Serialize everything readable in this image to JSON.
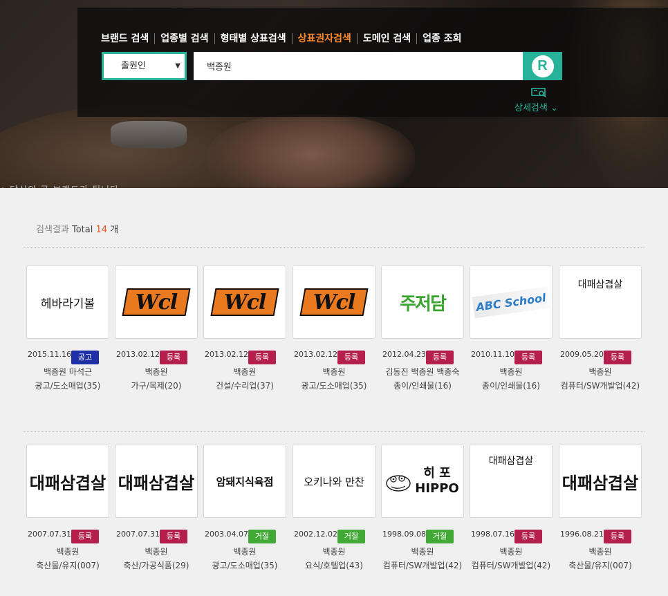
{
  "nav": {
    "items": [
      {
        "label": "브랜드 검색",
        "active": false
      },
      {
        "label": "업종별 검색",
        "active": false
      },
      {
        "label": "형태별 상표검색",
        "active": false
      },
      {
        "label": "상표권자검색",
        "active": true
      },
      {
        "label": "도메인 검색",
        "active": false
      },
      {
        "label": "업종 조회",
        "active": false
      }
    ]
  },
  "search": {
    "select_value": "출원인",
    "query": "백종원",
    "advanced_label": "상세검색"
  },
  "hero": {
    "ticker": "e 당신의 곧 브랜드가 됩니다"
  },
  "results": {
    "label": "검색결과",
    "total_label": "Total",
    "count": "14",
    "unit": "개",
    "items": [
      {
        "logo": "헤바라기볼",
        "date": "2015.11.16",
        "status": "공고",
        "owner": "백종원 마석근",
        "category": "광고/도소매업(35)"
      },
      {
        "logo": "Wcl",
        "date": "2013.02.12",
        "status": "등록",
        "owner": "백종원",
        "category": "가구/목제(20)"
      },
      {
        "logo": "Wcl",
        "date": "2013.02.12",
        "status": "등록",
        "owner": "백종원",
        "category": "건설/수리업(37)"
      },
      {
        "logo": "Wcl",
        "date": "2013.02.12",
        "status": "등록",
        "owner": "백종원",
        "category": "광고/도소매업(35)"
      },
      {
        "logo": "주저담",
        "date": "2012.04.23",
        "status": "등록",
        "owner": "김동진 백종원 백종숙",
        "category": "종이/인쇄물(16)"
      },
      {
        "logo": "ABC School",
        "date": "2010.11.10",
        "status": "등록",
        "owner": "백종원",
        "category": "종이/인쇄물(16)"
      },
      {
        "logo": "대패삼겹살",
        "date": "2009.05.20",
        "status": "등록",
        "owner": "백종원",
        "category": "컴퓨터/SW개발업(42)"
      },
      {
        "logo": "대패삼겹살",
        "date": "2007.07.31",
        "status": "등록",
        "owner": "백종원",
        "category": "축산물/유지(007)"
      },
      {
        "logo": "대패삼겹살",
        "date": "2007.07.31",
        "status": "등록",
        "owner": "백종원",
        "category": "축산/가공식품(29)"
      },
      {
        "logo": "암돼지식육점",
        "date": "2003.04.07",
        "status": "거절",
        "owner": "백종원",
        "category": "광고/도소매업(35)"
      },
      {
        "logo": "오키나와 만찬",
        "date": "2002.12.02",
        "status": "거절",
        "owner": "백종원",
        "category": "요식/호텔업(43)"
      },
      {
        "logo": "히 포 HIPPO",
        "date": "1998.09.08",
        "status": "거절",
        "owner": "백종원",
        "category": "컴퓨터/SW개발업(42)"
      },
      {
        "logo": "대패삼겹살",
        "date": "1998.07.16",
        "status": "등록",
        "owner": "백종원",
        "category": "컴퓨터/SW개발업(42)"
      },
      {
        "logo": "대패삼겹살",
        "date": "1996.08.21",
        "status": "등록",
        "owner": "백종원",
        "category": "축산물/유지(007)"
      }
    ]
  },
  "colors": {
    "accent": "#27b29a",
    "active_nav": "#ff8a2b",
    "badge_notice": "#1f2fa8",
    "badge_registered": "#b41f4d",
    "badge_rejected": "#43a936",
    "count": "#e8551e"
  }
}
